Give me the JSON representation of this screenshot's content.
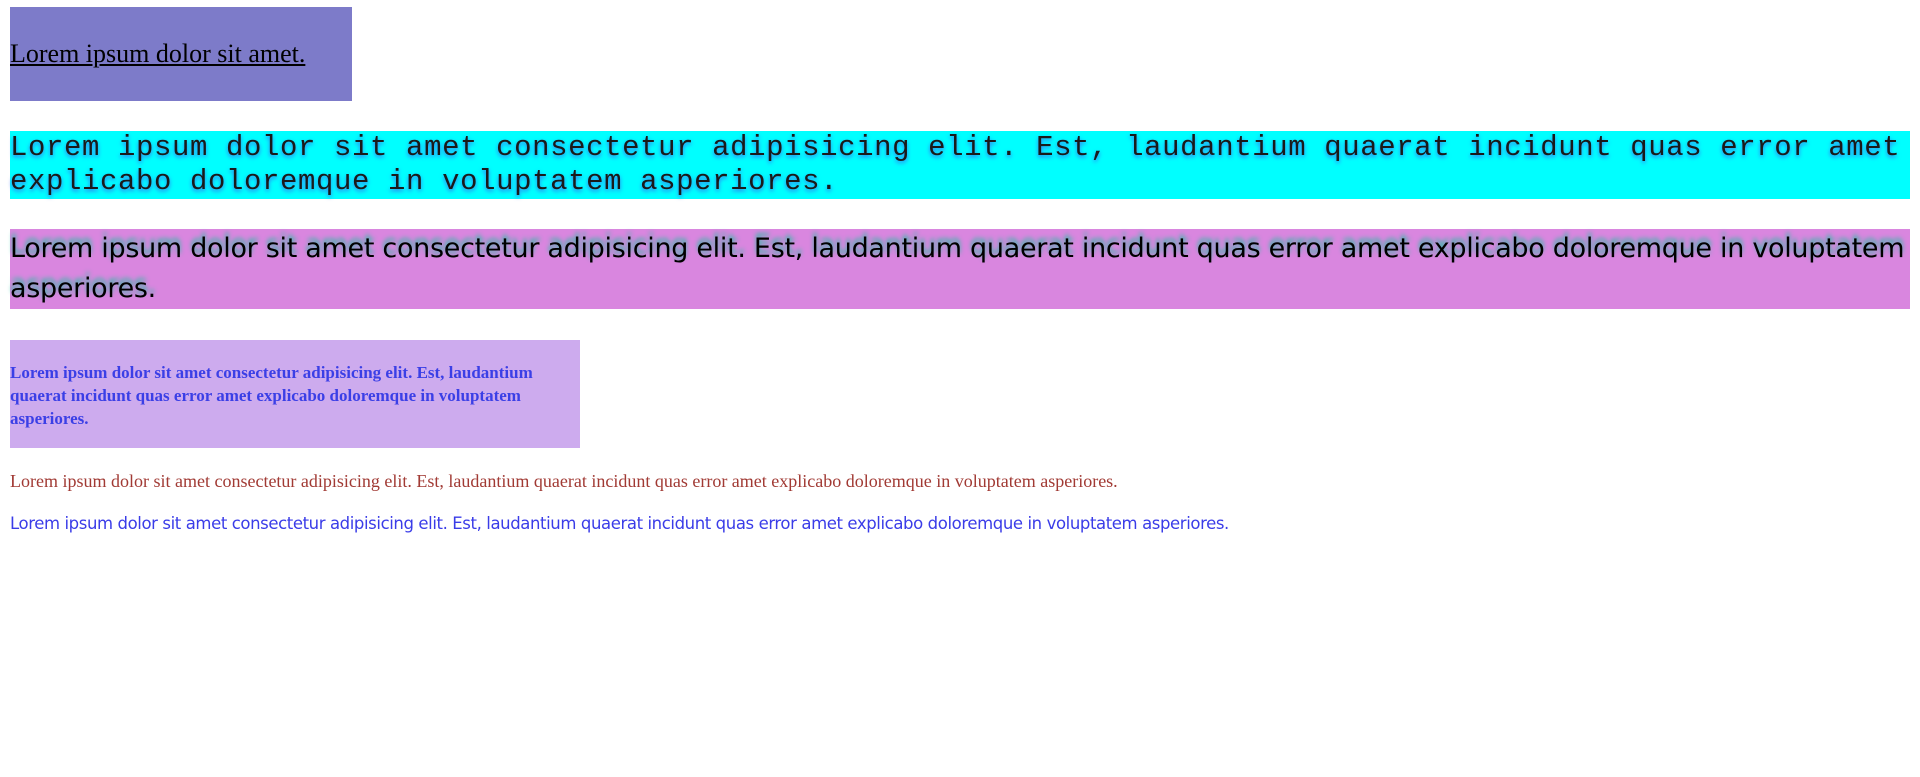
{
  "blocks": {
    "heading_short": "Lorem ipsum dolor sit amet.",
    "mono_paragraph": "Lorem ipsum dolor sit amet consectetur adipisicing elit. Est, laudantium quaerat incidunt quas error amet explicabo doloremque in voluptatem asperiores.",
    "sans_paragraph": "Lorem ipsum dolor sit amet consectetur adipisicing elit. Est, laudantium quaerat incidunt quas error amet explicabo doloremque in voluptatem asperiores.",
    "bold_paragraph": "Lorem ipsum dolor sit amet consectetur adipisicing elit. Est, laudantium quaerat incidunt quas error amet explicabo doloremque in voluptatem asperiores.",
    "serif_red_paragraph": "Lorem ipsum dolor sit amet consectetur adipisicing elit. Est, laudantium quaerat incidunt quas error amet explicabo doloremque in voluptatem asperiores.",
    "sans_blue_paragraph": "Lorem ipsum dolor sit amet consectetur adipisicing elit. Est, laudantium quaerat incidunt quas error amet explicabo doloremque in voluptatem asperiores."
  },
  "colors": {
    "block1_bg": "#7d7bc9",
    "block2_bg": "#00ffff",
    "block3_bg": "#d986df",
    "block4_bg": "#cdabee",
    "block4_text": "#3b3fe6",
    "block5_text": "#a13a34",
    "block6_text": "#3a3ce8"
  }
}
